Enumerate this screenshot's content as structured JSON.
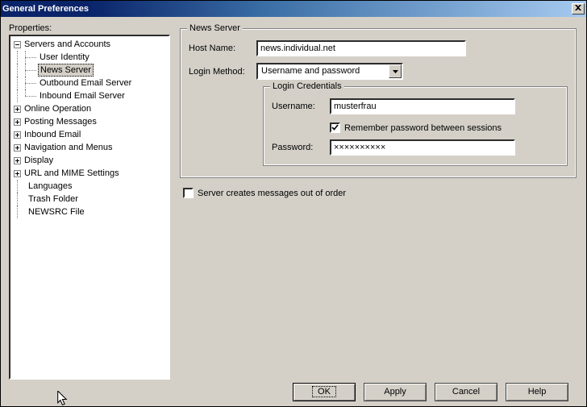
{
  "window": {
    "title": "General Preferences",
    "close_x": "✕"
  },
  "left": {
    "label": "Properties:"
  },
  "tree": {
    "root": "Servers and Accounts",
    "children": [
      "User Identity",
      "News Server",
      "Outbound Email Server",
      "Inbound Email Server"
    ],
    "siblings": [
      "Online Operation",
      "Posting Messages",
      "Inbound Email",
      "Navigation and Menus",
      "Display",
      "URL and MIME Settings",
      "Languages",
      "Trash Folder",
      "NEWSRC File"
    ],
    "selected": "News Server"
  },
  "news_server": {
    "legend": "News Server",
    "host_label": "Host Name:",
    "host_value": "news.individual.net",
    "login_method_label": "Login Method:",
    "login_method_value": "Username and password",
    "credentials": {
      "legend": "Login Credentials",
      "username_label": "Username:",
      "username_value": "musterfrau",
      "remember_label": "Remember password between sessions",
      "remember_checked": true,
      "password_label": "Password:",
      "password_value": "××××××××××"
    },
    "out_of_order_label": "Server creates messages out of order",
    "out_of_order_checked": false
  },
  "buttons": {
    "ok": "OK",
    "apply": "Apply",
    "cancel": "Cancel",
    "help": "Help"
  }
}
